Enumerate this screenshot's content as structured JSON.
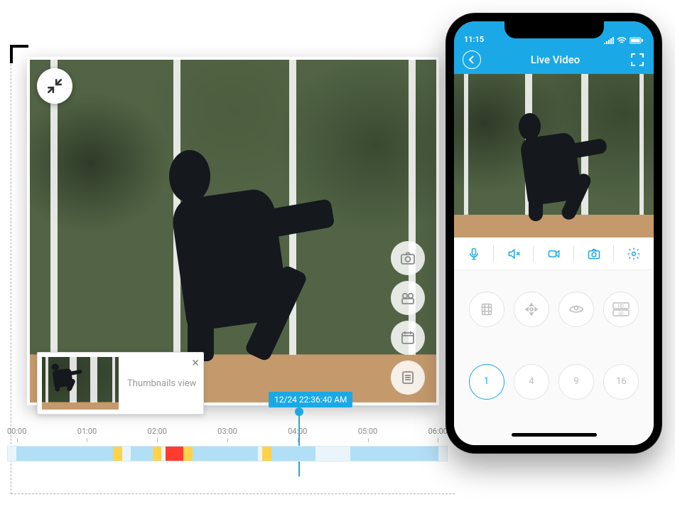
{
  "desktop": {
    "thumbnail_label": "Thumbnails view",
    "timestamp_tag": "12/24 22:36:40 AM",
    "side_button_icons": [
      "camera",
      "video",
      "calendar",
      "list"
    ],
    "timeline": {
      "ticks": [
        "00:00",
        "01:00",
        "02:00",
        "03:00",
        "04:00",
        "05:00",
        "06:00"
      ],
      "segments": [
        {
          "color": "blue",
          "start": 2,
          "width": 22
        },
        {
          "color": "yellow",
          "start": 24,
          "width": 2
        },
        {
          "color": "blue",
          "start": 28,
          "width": 5
        },
        {
          "color": "yellow",
          "start": 33,
          "width": 2
        },
        {
          "color": "red",
          "start": 36,
          "width": 4
        },
        {
          "color": "yellow",
          "start": 40,
          "width": 2
        },
        {
          "color": "blue",
          "start": 42,
          "width": 15
        },
        {
          "color": "yellow",
          "start": 58,
          "width": 2
        },
        {
          "color": "blue",
          "start": 60,
          "width": 10
        },
        {
          "color": "blue",
          "start": 78,
          "width": 20
        }
      ]
    }
  },
  "phone": {
    "status_time": "11:15",
    "title": "Live Video",
    "toolbar_icons": [
      "mic",
      "mute",
      "record",
      "snapshot",
      "settings"
    ],
    "feature_icons": [
      "clips",
      "ptz",
      "cloud",
      "quality"
    ],
    "camera_counts": [
      "1",
      "4",
      "9",
      "16"
    ],
    "active_count_index": 0
  },
  "colors": {
    "accent": "#1aa9e6"
  }
}
